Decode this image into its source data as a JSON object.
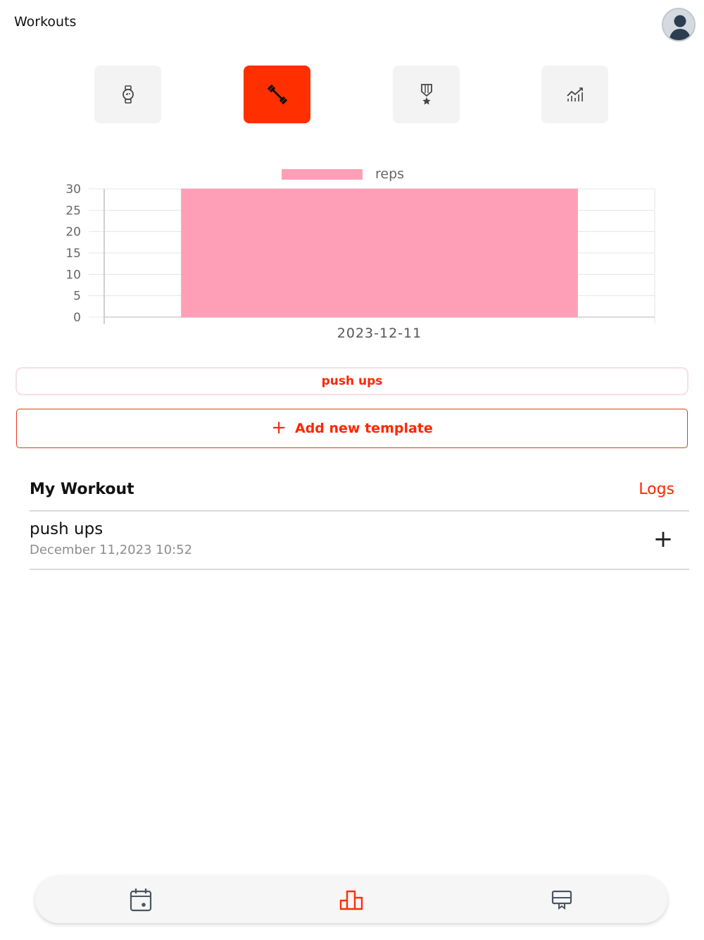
{
  "header": {
    "title": "Workouts"
  },
  "tabs": [
    {
      "icon": "watch-icon",
      "active": false
    },
    {
      "icon": "dumbbell-icon",
      "active": true
    },
    {
      "icon": "medal-icon",
      "active": false
    },
    {
      "icon": "chart-icon",
      "active": false
    }
  ],
  "chart_data": {
    "type": "bar",
    "categories": [
      "2023-12-11"
    ],
    "series": [
      {
        "name": "reps",
        "values": [
          30
        ]
      }
    ],
    "title": "",
    "xlabel": "",
    "ylabel": "",
    "ylim": [
      0,
      30
    ],
    "yticks": [
      "30",
      "25",
      "20",
      "15",
      "10",
      "5",
      "0"
    ],
    "grid": true,
    "legend": "top-center",
    "bar_color": "#ff9fb7"
  },
  "filter": {
    "label": "push ups"
  },
  "add_template": {
    "icon": "+",
    "label": "Add new template"
  },
  "section": {
    "title": "My Workout",
    "logs_label": "Logs"
  },
  "workouts": [
    {
      "name": "push ups",
      "date": "December 11,2023 10:52",
      "add_icon": "+"
    }
  ],
  "bottom_nav": [
    {
      "icon": "calendar-icon",
      "active": false
    },
    {
      "icon": "bar-chart-icon",
      "active": true
    },
    {
      "icon": "screen-icon",
      "active": false
    }
  ],
  "colors": {
    "accent": "#ff2f00",
    "bar": "#ff9fb7",
    "muted": "#8d8d8d"
  }
}
